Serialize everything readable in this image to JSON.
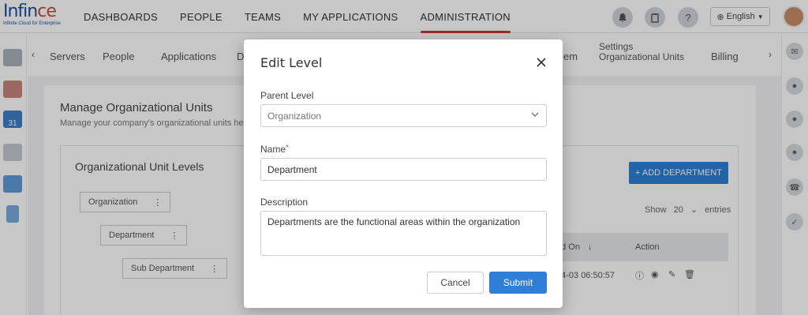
{
  "header": {
    "logo_text_main": "Infin",
    "logo_text_accent": "ce",
    "logo_tagline": "Infinite Cloud for Enterprise",
    "nav": [
      "DASHBOARDS",
      "PEOPLE",
      "TEAMS",
      "MY APPLICATIONS",
      "ADMINISTRATION"
    ],
    "active_nav": "ADMINISTRATION",
    "language": "English",
    "icons": [
      "bell-icon",
      "clipboard-icon",
      "help-icon",
      "globe-icon"
    ]
  },
  "subnav": {
    "items": [
      "Servers",
      "People",
      "Applications",
      "D",
      "em"
    ],
    "settings_line1": "Settings",
    "settings_line2": "Organizational Units",
    "billing": "Billing"
  },
  "page": {
    "title": "Manage Organizational Units",
    "subtitle": "Manage your company's organizational units he",
    "card_title": "Organizational Unit Levels",
    "tree": [
      "Organization",
      "Department",
      "Sub Department"
    ],
    "add_button": "+ ADD DEPARTMENT",
    "entries_show": "Show",
    "entries_count": "20",
    "entries_label": "entries",
    "table_header_date": "ed On",
    "table_header_action": "Action",
    "row_date": "04-03 06:50:57"
  },
  "modal": {
    "title": "Edit Level",
    "parent_label": "Parent Level",
    "parent_value": "Organization",
    "name_label": "Name",
    "name_required": "*",
    "name_value": "Department",
    "description_label": "Description",
    "description_value": "Departments are the functional areas within the organization",
    "cancel_label": "Cancel",
    "submit_label": "Submit"
  },
  "colors": {
    "primary": "#2f7fd9",
    "accent_underline": "#c0392b",
    "required": "#d9534f",
    "overlay": "rgba(0,0,0,0.22)"
  }
}
